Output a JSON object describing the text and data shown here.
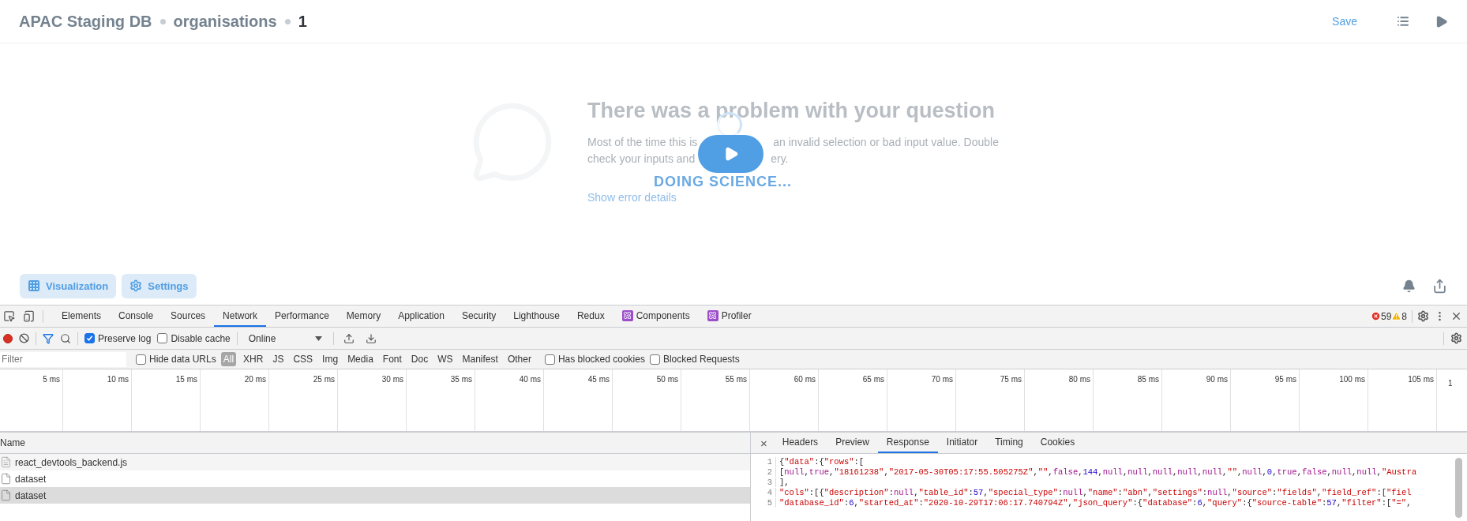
{
  "header": {
    "breadcrumbs": [
      "APAC Staging DB",
      "organisations",
      "1"
    ],
    "save": "Save"
  },
  "error": {
    "title": "There was a problem with your question",
    "body_lines": [
      [
        "Most of the time this is",
        "an invalid selection or bad input value. Double"
      ],
      [
        "check your inputs and",
        "ery."
      ]
    ],
    "link": "Show error details"
  },
  "loading": {
    "label": "DOING SCIENCE..."
  },
  "footer": {
    "buttons": [
      {
        "label": "Visualization",
        "kind": "grid"
      },
      {
        "label": "Settings",
        "kind": "gear"
      }
    ]
  },
  "devtools": {
    "tabs": [
      {
        "label": "Elements",
        "selected": false,
        "kind": "plain"
      },
      {
        "label": "Console",
        "selected": false,
        "kind": "plain"
      },
      {
        "label": "Sources",
        "selected": false,
        "kind": "plain"
      },
      {
        "label": "Network",
        "selected": true,
        "kind": "plain"
      },
      {
        "label": "Performance",
        "selected": false,
        "kind": "plain"
      },
      {
        "label": "Memory",
        "selected": false,
        "kind": "plain"
      },
      {
        "label": "Application",
        "selected": false,
        "kind": "plain"
      },
      {
        "label": "Security",
        "selected": false,
        "kind": "plain"
      },
      {
        "label": "Lighthouse",
        "selected": false,
        "kind": "plain"
      },
      {
        "label": "Redux",
        "selected": false,
        "kind": "plain"
      },
      {
        "label": "Components",
        "selected": false,
        "kind": "react"
      },
      {
        "label": "Profiler",
        "selected": false,
        "kind": "react"
      }
    ],
    "errors": "59",
    "warnings": "8",
    "toolbar": {
      "preserve_log": {
        "label": "Preserve log",
        "checked": true
      },
      "disable_cache": {
        "label": "Disable cache",
        "checked": false
      },
      "throttle": "Online"
    },
    "filter": {
      "placeholder": "Filter",
      "hide_data_urls": {
        "label": "Hide data URLs",
        "checked": false
      },
      "types": [
        {
          "label": "All",
          "selected": true
        },
        {
          "label": "XHR",
          "selected": false
        },
        {
          "label": "JS",
          "selected": false
        },
        {
          "label": "CSS",
          "selected": false
        },
        {
          "label": "Img",
          "selected": false
        },
        {
          "label": "Media",
          "selected": false
        },
        {
          "label": "Font",
          "selected": false
        },
        {
          "label": "Doc",
          "selected": false
        },
        {
          "label": "WS",
          "selected": false
        },
        {
          "label": "Manifest",
          "selected": false
        },
        {
          "label": "Other",
          "selected": false
        }
      ],
      "blocked_cookies": {
        "label": "Has blocked cookies",
        "checked": false
      },
      "blocked_requests": {
        "label": "Blocked Requests",
        "checked": false
      }
    },
    "timeline": {
      "ticks": [
        "5 ms",
        "10 ms",
        "15 ms",
        "20 ms",
        "25 ms",
        "30 ms",
        "35 ms",
        "40 ms",
        "45 ms",
        "50 ms",
        "55 ms",
        "60 ms",
        "65 ms",
        "70 ms",
        "75 ms",
        "80 ms",
        "85 ms",
        "90 ms",
        "95 ms",
        "100 ms",
        "105 ms",
        "1"
      ]
    },
    "requests": {
      "column": "Name",
      "rows": [
        {
          "name": "react_devtools_backend.js",
          "kind": "script",
          "selected": false
        },
        {
          "name": "dataset",
          "kind": "document",
          "selected": false
        },
        {
          "name": "dataset",
          "kind": "document",
          "selected": true
        }
      ]
    },
    "detail": {
      "close": "×",
      "tabs": [
        {
          "label": "Headers",
          "selected": false
        },
        {
          "label": "Preview",
          "selected": false
        },
        {
          "label": "Response",
          "selected": true
        },
        {
          "label": "Initiator",
          "selected": false
        },
        {
          "label": "Timing",
          "selected": false
        },
        {
          "label": "Cookies",
          "selected": false
        }
      ],
      "lines": [
        {
          "number": "1",
          "code": "{\"data\":{\"rows\":["
        },
        {
          "number": "2",
          "code": "[null,true,\"18161238\",\"2017-05-30T05:17:55.505275Z\",\"\",false,144,null,null,null,null,null,\"\",null,0,true,false,null,null,\"Austra"
        },
        {
          "number": "3",
          "code": "],"
        },
        {
          "number": "4",
          "code": "\"cols\":[{\"description\":null,\"table_id\":57,\"special_type\":null,\"name\":\"abn\",\"settings\":null,\"source\":\"fields\",\"field_ref\":[\"fiel"
        },
        {
          "number": "5",
          "code": "\"database_id\":6,\"started_at\":\"2020-10-29T17:06:17.740794Z\",\"json_query\":{\"database\":6,\"query\":{\"source-table\":57,\"filter\":[\"=\","
        }
      ]
    }
  }
}
